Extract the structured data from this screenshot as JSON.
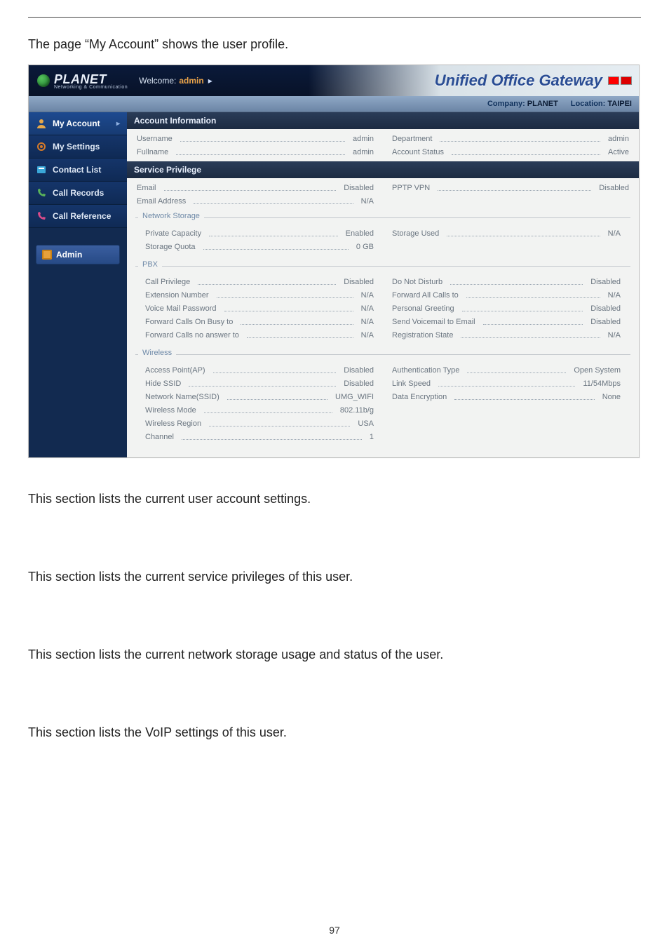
{
  "page": {
    "intro": "The page “My Account” shows the user profile.",
    "body1": "This section lists the current user account settings.",
    "body2": "This section lists the current service privileges of this user.",
    "body3": "This section lists the current network storage usage and status of the user.",
    "body4": "This section lists the VoIP settings of this user.",
    "page_number": "97"
  },
  "app": {
    "brand": "PLANET",
    "brand_sub": "Networking & Communication",
    "welcome_label": "Welcome:",
    "welcome_user": "admin",
    "title": "Unified Office Gateway",
    "company_label": "Company:",
    "company_value": "PLANET",
    "location_label": "Location:",
    "location_value": "TAIPEI"
  },
  "nav": {
    "items": [
      {
        "id": "my-account",
        "label": "My Account",
        "active": true
      },
      {
        "id": "my-settings",
        "label": "My Settings",
        "active": false
      },
      {
        "id": "contact-list",
        "label": "Contact List",
        "active": false
      },
      {
        "id": "call-records",
        "label": "Call Records",
        "active": false
      },
      {
        "id": "call-reference",
        "label": "Call Reference",
        "active": false
      }
    ],
    "admin_label": "Admin"
  },
  "sections": {
    "account_info": {
      "title": "Account Information",
      "rows": [
        {
          "l": "Username",
          "v": "admin",
          "l2": "Department",
          "v2": "admin"
        },
        {
          "l": "Fullname",
          "v": "admin",
          "l2": "Account Status",
          "v2": "Active"
        }
      ]
    },
    "service_privilege": {
      "title": "Service Privilege",
      "rows": [
        {
          "l": "Email",
          "v": "Disabled",
          "l2": "PPTP VPN",
          "v2": "Disabled"
        },
        {
          "l": "Email Address",
          "v": "N/A",
          "l2": "",
          "v2": ""
        }
      ],
      "network_storage": {
        "legend": "Network Storage",
        "rows": [
          {
            "l": "Private Capacity",
            "v": "Enabled",
            "l2": "Storage Used",
            "v2": "N/A"
          },
          {
            "l": "Storage Quota",
            "v": "0 GB",
            "l2": "",
            "v2": ""
          }
        ]
      },
      "pbx": {
        "legend": "PBX",
        "rows": [
          {
            "l": "Call Privilege",
            "v": "Disabled",
            "l2": "Do Not Disturb",
            "v2": "Disabled"
          },
          {
            "l": "Extension Number",
            "v": "N/A",
            "l2": "Forward All Calls to",
            "v2": "N/A"
          },
          {
            "l": "Voice Mail Password",
            "v": "N/A",
            "l2": "Personal Greeting",
            "v2": "Disabled"
          },
          {
            "l": "Forward Calls On Busy to",
            "v": "N/A",
            "l2": "Send Voicemail to Email",
            "v2": "Disabled"
          },
          {
            "l": "Forward Calls no answer to",
            "v": "N/A",
            "l2": "Registration State",
            "v2": "N/A"
          }
        ]
      },
      "wireless": {
        "legend": "Wireless",
        "rows": [
          {
            "l": "Access Point(AP)",
            "v": "Disabled",
            "l2": "Authentication Type",
            "v2": "Open System"
          },
          {
            "l": "Hide SSID",
            "v": "Disabled",
            "l2": "Link Speed",
            "v2": "11/54Mbps"
          },
          {
            "l": "Network Name(SSID)",
            "v": "UMG_WIFI",
            "l2": "Data Encryption",
            "v2": "None"
          },
          {
            "l": "Wireless Mode",
            "v": "802.11b/g",
            "l2": "",
            "v2": ""
          },
          {
            "l": "Wireless Region",
            "v": "USA",
            "l2": "",
            "v2": ""
          },
          {
            "l": "Channel",
            "v": "1",
            "l2": "",
            "v2": ""
          }
        ]
      }
    }
  }
}
